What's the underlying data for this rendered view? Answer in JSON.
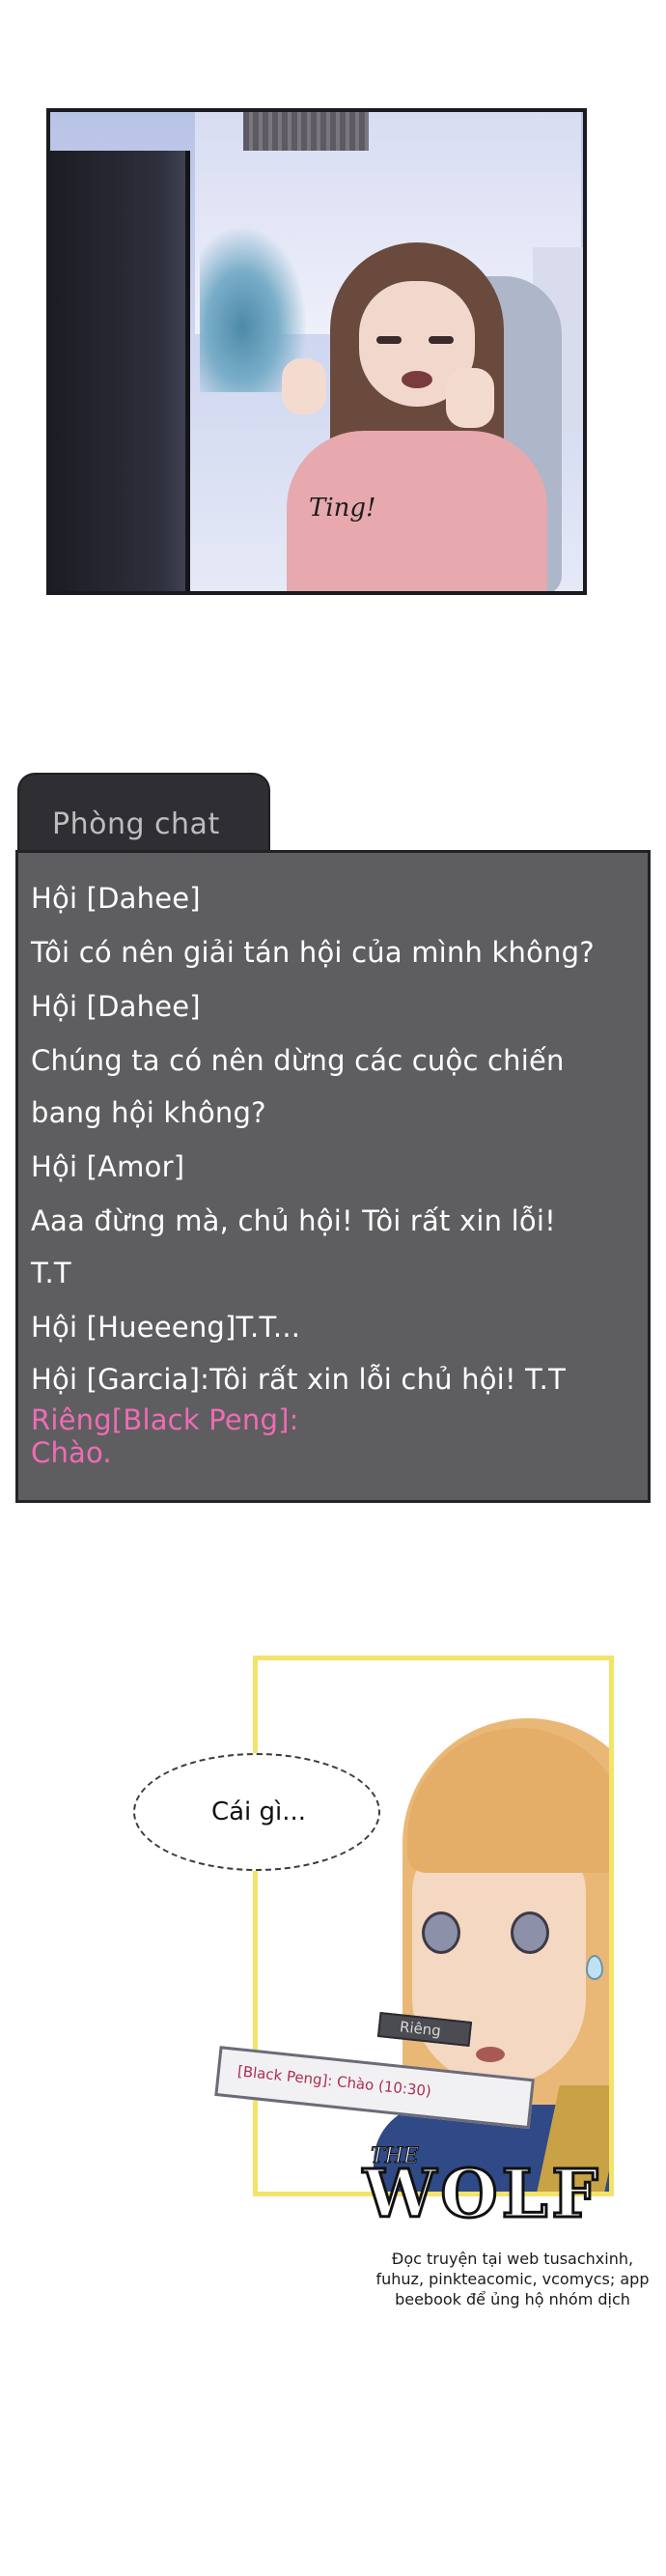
{
  "panel1": {
    "sound_effect": "Ting!"
  },
  "chat": {
    "tab_label": "Phòng chat",
    "lines": [
      {
        "text": "Hội [Dahee]",
        "color": "#ffffff"
      },
      {
        "text": "Tôi có nên giải tán hội của mình không?",
        "color": "#ffffff"
      },
      {
        "text": "Hội [Dahee]",
        "color": "#ffffff"
      },
      {
        "text": "Chúng ta có nên dừng các cuộc chiến",
        "color": "#ffffff"
      },
      {
        "text": "bang hội không?",
        "color": "#ffffff"
      },
      {
        "text": "Hội [Amor]",
        "color": "#ffffff"
      },
      {
        "text": "Aaa đừng mà, chủ hội! Tôi rất xin lỗi!",
        "color": "#ffffff"
      },
      {
        "text": "T.T",
        "color": "#ffffff"
      },
      {
        "text": "Hội [Hueeeng]T.T...",
        "color": "#ffffff"
      },
      {
        "text": "Hội [Garcia]:Tôi rất xin lỗi chủ hội! T.T",
        "color": "#ffffff"
      },
      {
        "text": "Riêng[Black Peng]:",
        "color": "#f06bb4"
      },
      {
        "text": "Chào.",
        "color": "#f06bb4"
      }
    ]
  },
  "panel3": {
    "speech": "Cái gì...",
    "notification_tab": "Riêng",
    "notification_text": "[Black Peng]: Chào (10:30)"
  },
  "watermark": {
    "logo_small": "THE",
    "logo_big": "WOLF",
    "credit_lines": [
      "Đọc truyện tại web tusachxinh,",
      "fuhuz, pinkteacomic, vcomycs; app",
      "beebook để ủng hộ nhóm dịch"
    ]
  }
}
